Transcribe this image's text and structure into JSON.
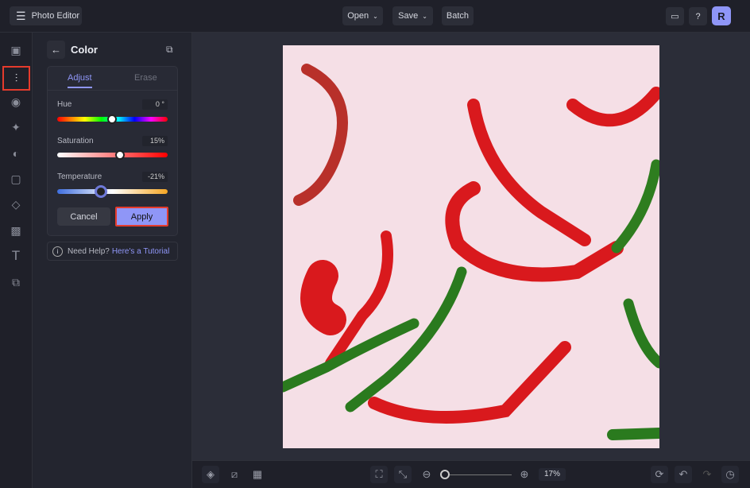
{
  "app": {
    "title": "Photo Editor",
    "avatar_initial": "R"
  },
  "toolbar": {
    "open": "Open",
    "save": "Save",
    "batch": "Batch"
  },
  "panel": {
    "title": "Color",
    "tabs": [
      {
        "label": "Adjust",
        "active": true
      },
      {
        "label": "Erase",
        "active": false
      }
    ],
    "sliders": [
      {
        "label": "Hue",
        "value_text": "0 °",
        "value": 0,
        "min": -180,
        "max": 180
      },
      {
        "label": "Saturation",
        "value_text": "15%",
        "value": 15,
        "min": -100,
        "max": 100
      },
      {
        "label": "Temperature",
        "value_text": "-21%",
        "value": -21,
        "min": -100,
        "max": 100
      }
    ],
    "cancel": "Cancel",
    "apply": "Apply",
    "help_prefix": "Need Help?",
    "help_link": "Here's a Tutorial"
  },
  "zoom": {
    "text": "17%",
    "value": 17
  },
  "colors": {
    "accent": "#7b83f5",
    "highlight": "#e53b2c",
    "photo_bg": "#f5dfe6"
  }
}
